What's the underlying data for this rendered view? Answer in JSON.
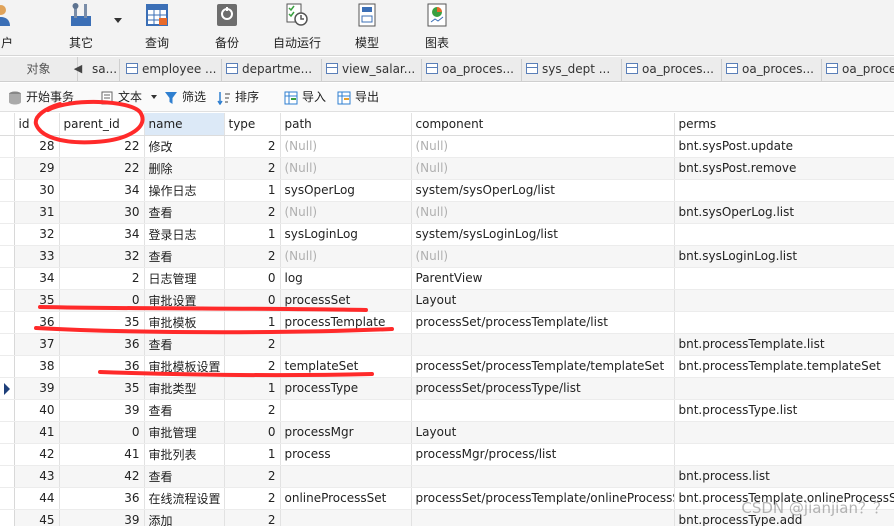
{
  "ribbon": {
    "items": [
      {
        "label": "用户",
        "icon": "user-icon"
      },
      {
        "label": "其它",
        "icon": "tools-icon"
      },
      {
        "label": "查询",
        "icon": "query-grid-icon"
      },
      {
        "label": "备份",
        "icon": "backup-icon"
      },
      {
        "label": "自动运行",
        "icon": "schedule-icon"
      },
      {
        "label": "模型",
        "icon": "model-icon"
      },
      {
        "label": "图表",
        "icon": "chart-icon"
      }
    ]
  },
  "tabs": {
    "objects_label": "对象",
    "items": [
      "sa...",
      "employee ...",
      "departme...",
      "view_salar...",
      "oa_proces...",
      "sys_dept ...",
      "oa_proces...",
      "oa_proces...",
      "oa_proce"
    ]
  },
  "actions": {
    "begin_transaction": "开始事务",
    "text": "文本",
    "filter": "筛选",
    "sort": "排序",
    "import": "导入",
    "export": "导出"
  },
  "grid": {
    "columns": [
      "id",
      "parent_id",
      "name",
      "type",
      "path",
      "component",
      "perms"
    ],
    "null_text": "(Null)",
    "rows": [
      [
        "28",
        "22",
        "修改",
        "2",
        "(Null)",
        "(Null)",
        "bnt.sysPost.update"
      ],
      [
        "29",
        "22",
        "删除",
        "2",
        "(Null)",
        "(Null)",
        "bnt.sysPost.remove"
      ],
      [
        "30",
        "34",
        "操作日志",
        "1",
        "sysOperLog",
        "system/sysOperLog/list",
        ""
      ],
      [
        "31",
        "30",
        "查看",
        "2",
        "(Null)",
        "(Null)",
        "bnt.sysOperLog.list"
      ],
      [
        "32",
        "34",
        "登录日志",
        "1",
        "sysLoginLog",
        "system/sysLoginLog/list",
        ""
      ],
      [
        "33",
        "32",
        "查看",
        "2",
        "(Null)",
        "(Null)",
        "bnt.sysLoginLog.list"
      ],
      [
        "34",
        "2",
        "日志管理",
        "0",
        "log",
        "ParentView",
        ""
      ],
      [
        "35",
        "0",
        "审批设置",
        "0",
        "processSet",
        "Layout",
        ""
      ],
      [
        "36",
        "35",
        "审批模板",
        "1",
        "processTemplate",
        "processSet/processTemplate/list",
        ""
      ],
      [
        "37",
        "36",
        "查看",
        "2",
        "",
        "",
        "bnt.processTemplate.list"
      ],
      [
        "38",
        "36",
        "审批模板设置",
        "2",
        "templateSet",
        "processSet/processTemplate/templateSet",
        "bnt.processTemplate.templateSet"
      ],
      [
        "39",
        "35",
        "审批类型",
        "1",
        "processType",
        "processSet/processType/list",
        ""
      ],
      [
        "40",
        "39",
        "查看",
        "2",
        "",
        "",
        "bnt.processType.list"
      ],
      [
        "41",
        "0",
        "审批管理",
        "0",
        "processMgr",
        "Layout",
        ""
      ],
      [
        "42",
        "41",
        "审批列表",
        "1",
        "process",
        "processMgr/process/list",
        ""
      ],
      [
        "43",
        "42",
        "查看",
        "2",
        "",
        "",
        "bnt.process.list"
      ],
      [
        "44",
        "36",
        "在线流程设置",
        "2",
        "onlineProcessSet",
        "processSet/processTemplate/onlineProcessS",
        "bnt.processTemplate.onlineProcessSe"
      ],
      [
        "45",
        "39",
        "添加",
        "2",
        "",
        "",
        "bnt.processType.add"
      ]
    ],
    "current_row_index": 11
  },
  "watermark": "CSDN @jianjian？？",
  "colors": {
    "annotation": "#ff2a2a",
    "selected_header": "#dce9f7",
    "null_text": "#b0b0b0"
  }
}
